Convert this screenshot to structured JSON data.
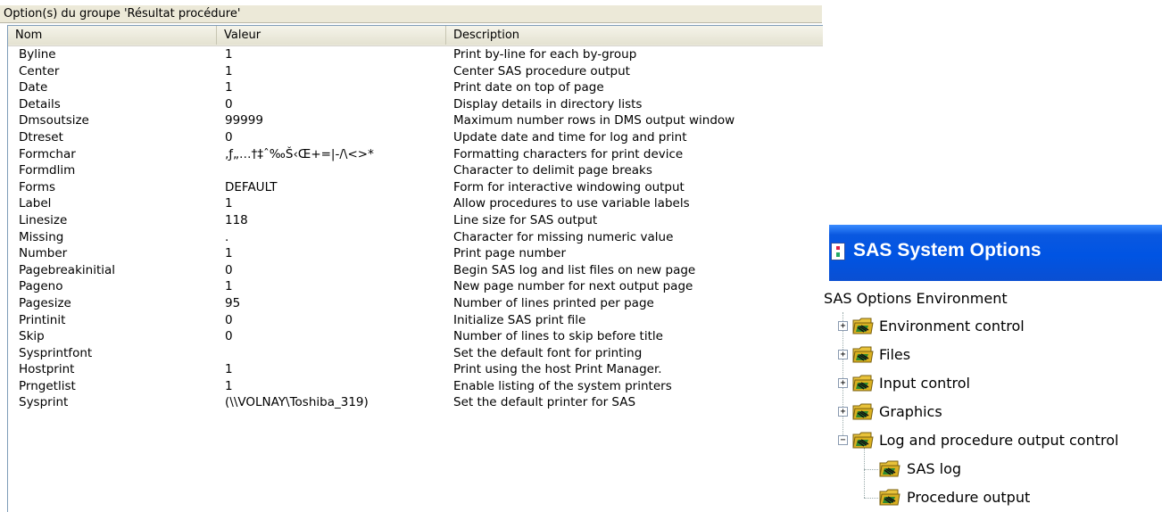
{
  "options_panel": {
    "group_title": "Option(s) du groupe 'Résultat procédure'",
    "columns": {
      "name": "Nom",
      "value": "Valeur",
      "description": "Description"
    },
    "rows": [
      {
        "name": "Byline",
        "value": "1",
        "description": "Print by-line for each by-group"
      },
      {
        "name": "Center",
        "value": "1",
        "description": "Center SAS procedure output"
      },
      {
        "name": "Date",
        "value": "1",
        "description": "Print date on top of page"
      },
      {
        "name": "Details",
        "value": "0",
        "description": "Display details in directory lists"
      },
      {
        "name": "Dmsoutsize",
        "value": "99999",
        "description": "Maximum number rows in DMS output window"
      },
      {
        "name": "Dtreset",
        "value": "0",
        "description": "Update date and time for log and print"
      },
      {
        "name": "Formchar",
        "value": "‚ƒ„…†‡ˆ‰Š‹Œ+=|-/\\<>*",
        "description": "Formatting characters for print device"
      },
      {
        "name": "Formdlim",
        "value": "",
        "description": "Character to delimit page breaks"
      },
      {
        "name": "Forms",
        "value": "DEFAULT",
        "description": "Form for interactive windowing output"
      },
      {
        "name": "Label",
        "value": "1",
        "description": "Allow procedures to use variable labels"
      },
      {
        "name": "Linesize",
        "value": "118",
        "description": "Line size for SAS output"
      },
      {
        "name": "Missing",
        "value": ".",
        "description": "Character for missing numeric value"
      },
      {
        "name": "Number",
        "value": "1",
        "description": "Print page number"
      },
      {
        "name": "Pagebreakinitial",
        "value": "0",
        "description": "Begin SAS log and list files on new page"
      },
      {
        "name": "Pageno",
        "value": "1",
        "description": "New page number for next output page"
      },
      {
        "name": "Pagesize",
        "value": "95",
        "description": "Number of lines printed per page"
      },
      {
        "name": "Printinit",
        "value": "0",
        "description": "Initialize SAS print file"
      },
      {
        "name": "Skip",
        "value": "0",
        "description": "Number of lines to skip before title"
      },
      {
        "name": "Sysprintfont",
        "value": "",
        "description": "Set the default font for printing"
      },
      {
        "name": "Hostprint",
        "value": "1",
        "description": "Print using the host Print Manager."
      },
      {
        "name": "Prngetlist",
        "value": "1",
        "description": "Enable listing of the system printers"
      },
      {
        "name": "Sysprint",
        "value": "(\\\\VOLNAY\\Toshiba_319)",
        "description": "Set the default printer for SAS"
      }
    ]
  },
  "sas_window": {
    "title": "SAS System Options",
    "environment_label": "SAS Options Environment",
    "tree": [
      {
        "label": "Environment control",
        "toggle": "+",
        "icon": "folder-icon"
      },
      {
        "label": "Files",
        "toggle": "+",
        "icon": "folder-icon"
      },
      {
        "label": "Input control",
        "toggle": "+",
        "icon": "folder-icon"
      },
      {
        "label": "Graphics",
        "toggle": "+",
        "icon": "folder-icon"
      },
      {
        "label": "Log and procedure output control",
        "toggle": "−",
        "icon": "folder-icon"
      },
      {
        "label": "SAS log",
        "toggle": "",
        "icon": "folder-icon"
      },
      {
        "label": "Procedure output",
        "toggle": "",
        "icon": "folder-icon"
      }
    ]
  }
}
